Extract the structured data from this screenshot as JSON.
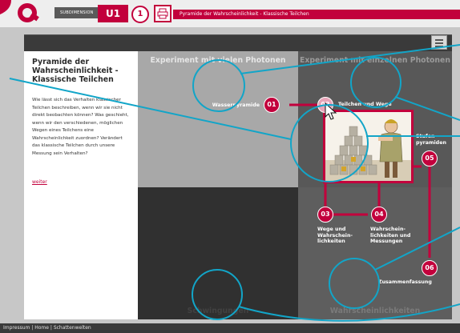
{
  "header": {
    "subdimension_label": "SUBDIMENSION",
    "unit_label": "U1",
    "step_label": "1",
    "title": "Pyramide der Wahrscheinlichkeit - Klassische Teilchen"
  },
  "left_panel": {
    "title": "Pyramide der Wahrscheinlichkeit - Klassische Teilchen",
    "text": "Wie lässt sich das Verhalten klassischer Teilchen beschreiben, wenn wir sie nicht direkt beobachten können? Was geschieht, wenn wir den verschiedenen, möglichen Wegen eines Teilchens eine Wahrscheinlichkeit zuordnen? Verändert das klassische Teilchen durch unsere Messung sein Verhalten?",
    "link": "weiter"
  },
  "quadrants": {
    "top_left": "Experiment mit vielen Photonen",
    "top_right": "Experiment mit einzelnen Photonen",
    "bottom_left": "Schwingungen",
    "bottom_right": "Wahrscheinlichkeiten"
  },
  "nodes": [
    {
      "id": "01",
      "label": "Wasserpyramide"
    },
    {
      "id": "02",
      "label": "Teilchen und Wege"
    },
    {
      "id": "03",
      "label": "Wege und Wahrschein-lichkeiten"
    },
    {
      "id": "04",
      "label": "Wahrschein-lichkeiten und Messungen"
    },
    {
      "id": "05",
      "label": "Stufen-pyramiden"
    },
    {
      "id": "06",
      "label": "Zusammenfassung"
    }
  ],
  "footer": {
    "impressum": "Impressum",
    "home": "Home",
    "schattenwelten": "Schattenwelten",
    "separator": "|"
  },
  "colors": {
    "accent": "#c2003c",
    "annotation": "#12a5c8"
  }
}
